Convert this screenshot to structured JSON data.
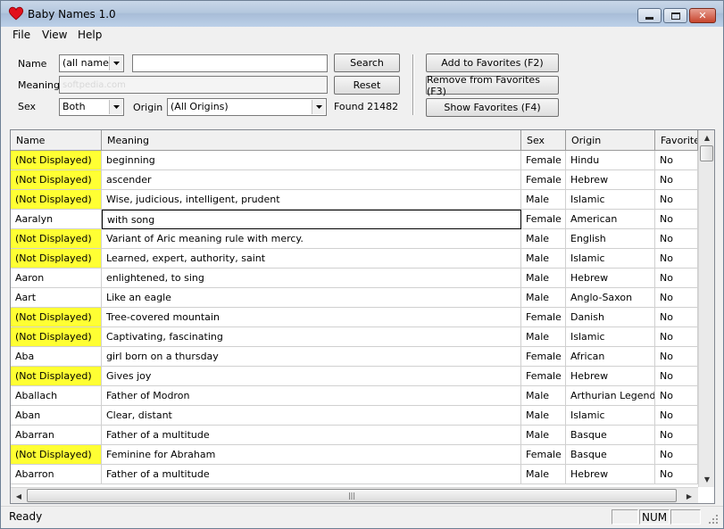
{
  "window": {
    "title": "Baby Names 1.0",
    "accent": "#ffff33"
  },
  "menu": [
    "File",
    "View",
    "Help"
  ],
  "search": {
    "name_label": "Name",
    "name_filter": "(all names)",
    "name_value": "",
    "meaning_label": "Meaning",
    "meaning_value": "",
    "watermark": "softpedia.com",
    "sex_label": "Sex",
    "sex_value": "Both",
    "origin_label": "Origin",
    "origin_value": "(All Origins)",
    "found_text": "Found 21482",
    "search_button": "Search",
    "reset_button": "Reset"
  },
  "favorites": {
    "add": "Add to Favorites (F2)",
    "remove": "Remove from Favorites (F3)",
    "show": "Show Favorites (F4)"
  },
  "table": {
    "headers": [
      "Name",
      "Meaning",
      "Sex",
      "Origin",
      "Favorite"
    ],
    "rows": [
      [
        "(Not Displayed)",
        "beginning",
        "Female",
        "Hindu",
        "No"
      ],
      [
        "(Not Displayed)",
        "ascender",
        "Female",
        "Hebrew",
        "No"
      ],
      [
        "(Not Displayed)",
        "Wise, judicious, intelligent, prudent",
        "Male",
        "Islamic",
        "No"
      ],
      [
        "Aaralyn",
        "with song",
        "Female",
        "American",
        "No"
      ],
      [
        "(Not Displayed)",
        "Variant of Aric meaning rule with mercy.",
        "Male",
        "English",
        "No"
      ],
      [
        "(Not Displayed)",
        "Learned, expert, authority, saint",
        "Male",
        "Islamic",
        "No"
      ],
      [
        "Aaron",
        "enlightened, to sing",
        "Male",
        "Hebrew",
        "No"
      ],
      [
        "Aart",
        "Like an eagle",
        "Male",
        "Anglo-Saxon",
        "No"
      ],
      [
        "(Not Displayed)",
        "Tree-covered mountain",
        "Female",
        "Danish",
        "No"
      ],
      [
        "(Not Displayed)",
        "Captivating, fascinating",
        "Male",
        "Islamic",
        "No"
      ],
      [
        "Aba",
        "girl born on a thursday",
        "Female",
        "African",
        "No"
      ],
      [
        "(Not Displayed)",
        "Gives joy",
        "Female",
        "Hebrew",
        "No"
      ],
      [
        "Aballach",
        "Father of Modron",
        "Male",
        "Arthurian Legend",
        "No"
      ],
      [
        "Aban",
        "Clear, distant",
        "Male",
        "Islamic",
        "No"
      ],
      [
        "Abarran",
        "Father of a multitude",
        "Male",
        "Basque",
        "No"
      ],
      [
        "(Not Displayed)",
        "Feminine for Abraham",
        "Female",
        "Basque",
        "No"
      ],
      [
        "Abarron",
        "Father of a multitude",
        "Male",
        "Hebrew",
        "No"
      ]
    ]
  },
  "status": {
    "text": "Ready",
    "num": "NUM"
  }
}
